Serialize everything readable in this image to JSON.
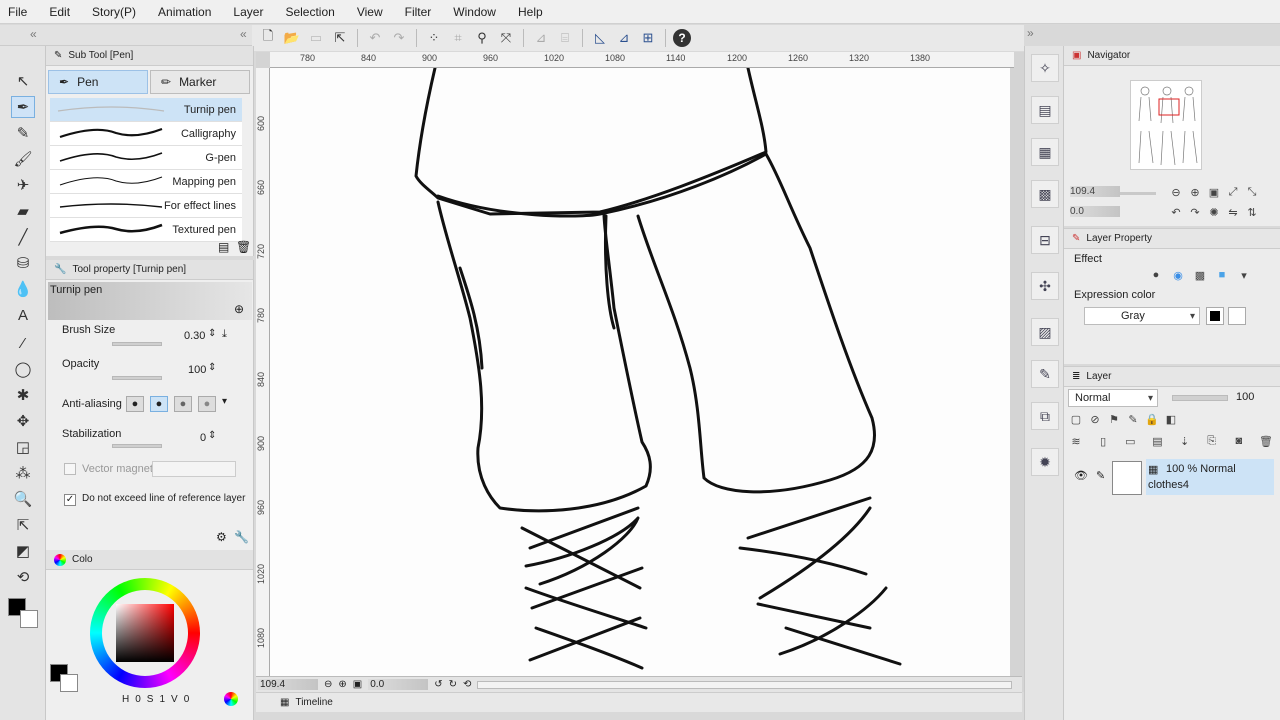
{
  "menu": [
    "File",
    "Edit",
    "Story(P)",
    "Animation",
    "Layer",
    "Selection",
    "View",
    "Filter",
    "Window",
    "Help"
  ],
  "subtool": {
    "header": "Sub Tool [Pen]",
    "tabs": [
      {
        "label": "Pen"
      },
      {
        "label": "Marker"
      }
    ],
    "brushes": [
      "Turnip pen",
      "Calligraphy",
      "G-pen",
      "Mapping pen",
      "For effect lines",
      "Textured pen"
    ]
  },
  "toolprop": {
    "header": "Tool property [Turnip pen]",
    "tool_name": "Turnip pen",
    "brush_size_label": "Brush Size",
    "brush_size_value": "0.30",
    "opacity_label": "Opacity",
    "opacity_value": "100",
    "antialias_label": "Anti-aliasing",
    "stabilization_label": "Stabilization",
    "stabilization_value": "0",
    "vector_magnet_label": "Vector magnet",
    "no_exceed_label": "Do not exceed line of reference layer"
  },
  "color": {
    "tab_label": "Colo",
    "main_color": "#000000",
    "sub_color": "#ffffff",
    "values": [
      "0",
      "S",
      "1",
      "V",
      "0"
    ]
  },
  "ruler_h": [
    "780",
    "840",
    "900",
    "960",
    "1020",
    "1080",
    "1140",
    "1200",
    "1260",
    "1320",
    "1380"
  ],
  "ruler_v": [
    "600",
    "660",
    "720",
    "780",
    "840",
    "900",
    "960",
    "1020",
    "1080"
  ],
  "status": {
    "zoom": "109.4",
    "angle": "0.0"
  },
  "timeline_label": "Timeline",
  "navigator": {
    "title": "Navigator",
    "zoom": "109.4",
    "angle": "0.0"
  },
  "layer_property": {
    "title": "Layer Property",
    "effect_label": "Effect",
    "expression_color_label": "Expression color",
    "expression_color_value": "Gray"
  },
  "layer_panel": {
    "title": "Layer",
    "blend_mode": "Normal",
    "opacity": "100",
    "layers": [
      {
        "info": "100 % Normal",
        "name": "clothes4"
      }
    ]
  }
}
